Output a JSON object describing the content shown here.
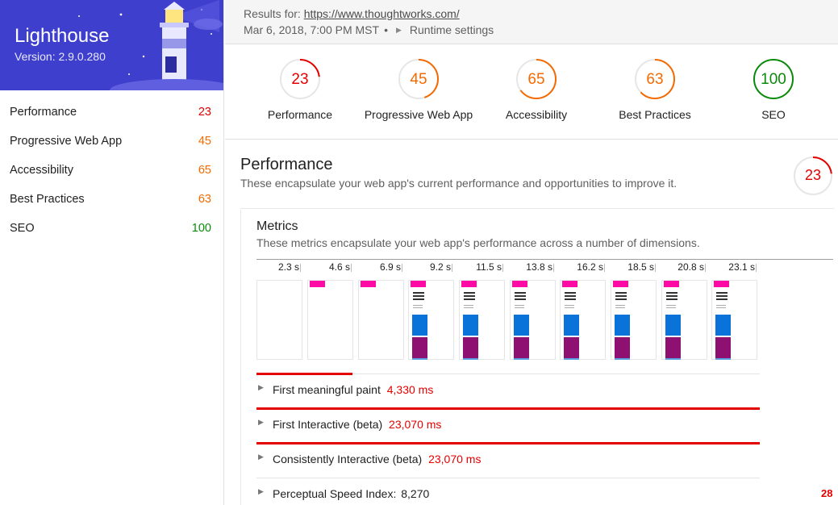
{
  "sidebar": {
    "brand_title": "Lighthouse",
    "brand_version": "Version: 2.9.0.280",
    "items": [
      {
        "label": "Performance",
        "score": "23",
        "color": "#e50000"
      },
      {
        "label": "Progressive Web App",
        "score": "45",
        "color": "#f56a00"
      },
      {
        "label": "Accessibility",
        "score": "65",
        "color": "#f56a00"
      },
      {
        "label": "Best Practices",
        "score": "63",
        "color": "#f56a00"
      },
      {
        "label": "SEO",
        "score": "100",
        "color": "#0a8a0a"
      }
    ]
  },
  "header": {
    "results_prefix": "Results for: ",
    "url": "https://www.thoughtworks.com/",
    "timestamp": "Mar 6, 2018, 7:00 PM MST",
    "separator": "•",
    "runtime_label": "Runtime settings"
  },
  "gauges": [
    {
      "label": "Performance",
      "score": "23",
      "fraction": 0.23,
      "color": "#e50000"
    },
    {
      "label": "Progressive Web App",
      "score": "45",
      "fraction": 0.45,
      "color": "#f56a00"
    },
    {
      "label": "Accessibility",
      "score": "65",
      "fraction": 0.65,
      "color": "#f56a00"
    },
    {
      "label": "Best Practices",
      "score": "63",
      "fraction": 0.63,
      "color": "#f56a00"
    },
    {
      "label": "SEO",
      "score": "100",
      "fraction": 1.0,
      "color": "#0a8a0a"
    }
  ],
  "performance": {
    "title": "Performance",
    "description": "These encapsulate your web app's current performance and opportunities to improve it.",
    "score": "23",
    "fraction": 0.23
  },
  "metrics": {
    "title": "Metrics",
    "description": "These metrics encapsulate your web app's performance across a number of dimensions.",
    "timeline_ticks": [
      "2.3 s",
      "4.6 s",
      "6.9 s",
      "9.2 s",
      "11.5 s",
      "13.8 s",
      "16.2 s",
      "18.5 s",
      "20.8 s",
      "23.1 s"
    ],
    "rows": [
      {
        "name": "First meaningful paint",
        "value": "4,330 ms",
        "bar_fraction": 0.19
      },
      {
        "name": "First Interactive (beta)",
        "value": "23,070 ms",
        "bar_fraction": 1.0
      },
      {
        "name": "Consistently Interactive (beta)",
        "value": "23,070 ms",
        "bar_fraction": 1.0
      },
      {
        "name": "Perceptual Speed Index:",
        "value": "8,270",
        "side_score": "28"
      }
    ]
  },
  "colors": {
    "brand": "#3f3fce",
    "fail": "#e50000",
    "average": "#f56a00",
    "pass": "#0a8a0a"
  }
}
